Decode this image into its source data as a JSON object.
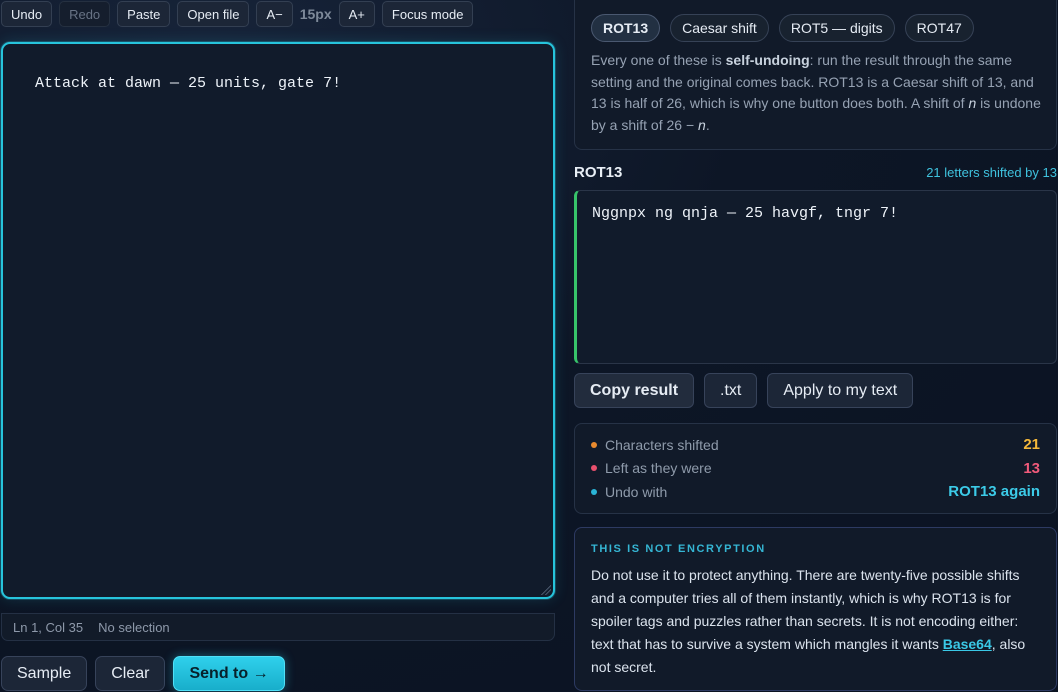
{
  "toolbar": {
    "undo": "Undo",
    "redo": "Redo",
    "paste": "Paste",
    "open_file": "Open file",
    "font_decrease": "A−",
    "font_size": "15px",
    "font_increase": "A+",
    "focus_mode": "Focus mode"
  },
  "editor": {
    "text": "Attack at dawn — 25 units, gate 7!"
  },
  "status": {
    "position": "Ln 1, Col 35",
    "selection": "No selection"
  },
  "actions": {
    "sample": "Sample",
    "clear": "Clear",
    "send_to": "Send to →"
  },
  "modes": {
    "items": [
      "ROT13",
      "Caesar shift",
      "ROT5 — digits",
      "ROT47"
    ],
    "selected": "ROT13",
    "desc_1": "Every one of these is ",
    "desc_bold": "self-undoing",
    "desc_2": ": run the result through the same setting and the original comes back. ROT13 is a Caesar shift of 13, and 13 is half of 26, which is why one button does both. A shift of ",
    "desc_n1": "n",
    "desc_3": " is undone by a shift of 26 − ",
    "desc_n2": "n",
    "desc_4": "."
  },
  "result": {
    "title": "ROT13",
    "note": "21 letters shifted by 13",
    "text": "Nggnpx ng qnja — 25 havgf, tngr 7!",
    "copy": "Copy result",
    "txt": ".txt",
    "apply": "Apply to my text"
  },
  "stats": [
    {
      "label": "Characters shifted",
      "value": "21",
      "color": "#f5b83a",
      "dot": "#e98a2e"
    },
    {
      "label": "Left as they were",
      "value": "13",
      "color": "#f05a7a",
      "dot": "#e8506d"
    },
    {
      "label": "Undo with",
      "value": "ROT13 again",
      "color": "#3ccbe8",
      "dot": "#2ab4d6"
    }
  ],
  "warning": {
    "title": "THIS IS NOT ENCRYPTION",
    "body_1": "Do not use it to protect anything. There are twenty-five possible shifts and a computer tries all of them instantly, which is why ROT13 is for spoiler tags and puzzles rather than secrets. It is not encoding either: text that has to survive a system which mangles it wants ",
    "link": "Base64",
    "body_2": ", also not secret."
  },
  "colors": {
    "accent": "#27c4dc",
    "result_bar": "#37c46a"
  }
}
